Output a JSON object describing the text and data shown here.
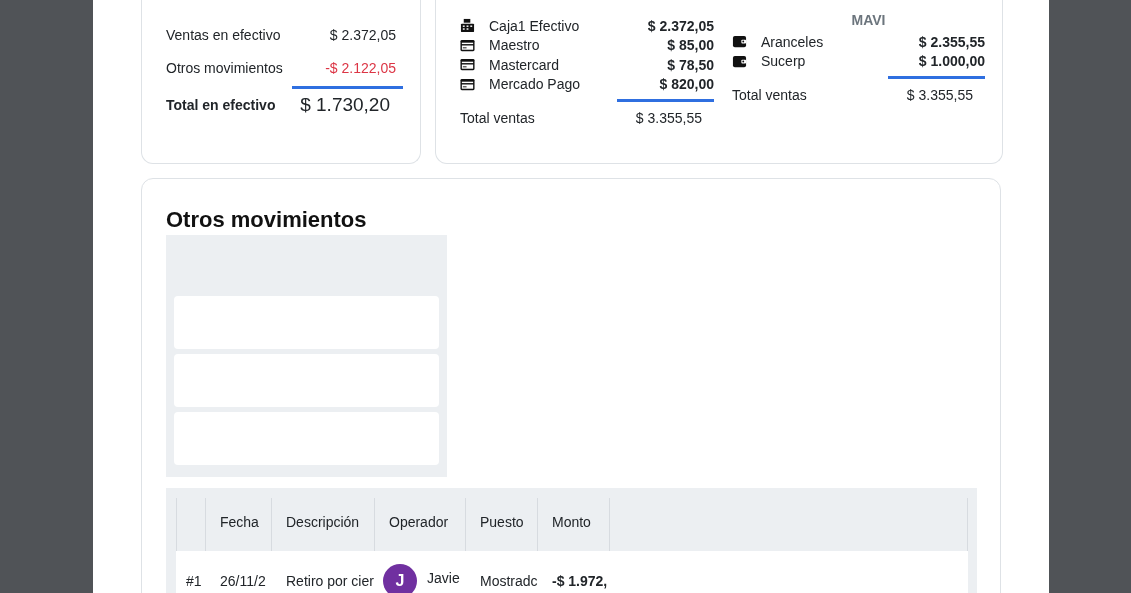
{
  "cash_summary": {
    "rows": [
      {
        "label": "Ventas en efectivo",
        "amount": "$ 2.372,05",
        "negative": false
      },
      {
        "label": "Otros movimientos",
        "amount": "-$ 2.122,05",
        "negative": true
      }
    ],
    "total": {
      "label": "Total en efectivo",
      "amount": "$ 1.730,20"
    }
  },
  "payment_methods": {
    "items": [
      {
        "kind": "register",
        "label": "Caja1 Efectivo",
        "amount": "$ 2.372,05"
      },
      {
        "kind": "card",
        "label": "Maestro",
        "amount": "$ 85,00"
      },
      {
        "kind": "card",
        "label": "Mastercard",
        "amount": "$ 78,50"
      },
      {
        "kind": "card",
        "label": "Mercado Pago",
        "amount": "$ 820,00"
      }
    ],
    "total": {
      "label": "Total ventas",
      "amount": "$ 3.355,55"
    }
  },
  "points_of_sale": {
    "group": "MAVI",
    "items": [
      {
        "kind": "wallet",
        "label": "Aranceles",
        "amount": "$ 2.355,55"
      },
      {
        "kind": "wallet",
        "label": "Sucerp",
        "amount": "$ 1.000,00"
      }
    ],
    "total": {
      "label": "Total ventas",
      "amount": "$ 3.355,55"
    }
  },
  "other_movements": {
    "title": "Otros movimientos",
    "table": {
      "columns": [
        "Fecha",
        "Descripción",
        "Operador",
        "Puesto",
        "Monto"
      ],
      "rows": [
        {
          "index": "#1",
          "date": "26/11/2",
          "description": "Retiro por cier",
          "operator_initial": "J",
          "operator": "Javie",
          "station": "Mostradc",
          "amount": "-$ 1.972,"
        }
      ]
    }
  }
}
